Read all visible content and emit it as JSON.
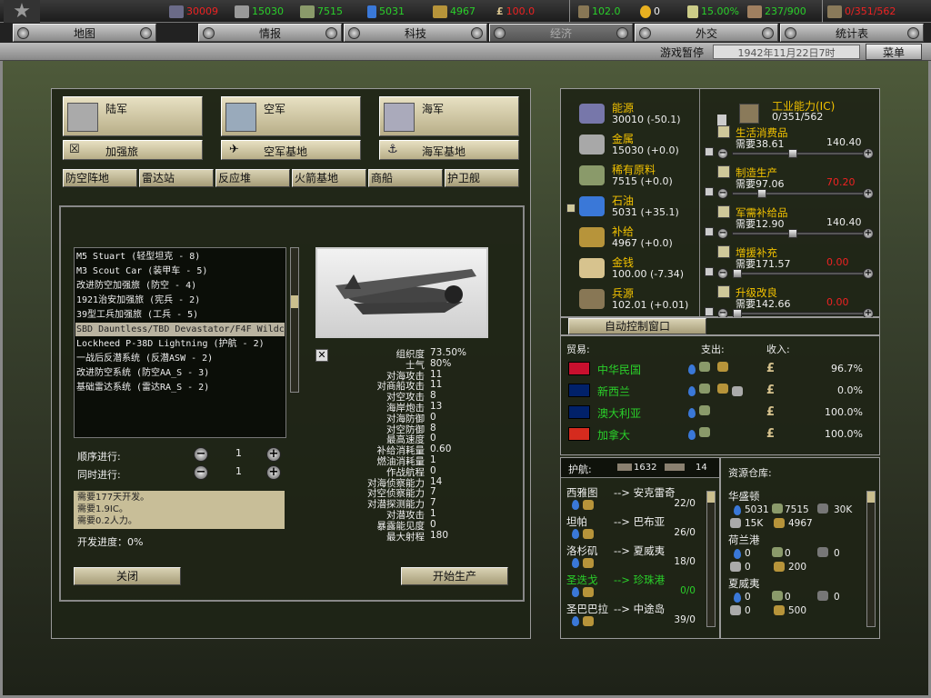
{
  "topbar": {
    "r1": "30009",
    "r2": "15030",
    "r3": "7515",
    "r4": "5031",
    "r5": "4967",
    "r6": "100.0",
    "r7": "102.0",
    "r8": "0",
    "r9": "15.00%",
    "r10": "237/900",
    "r11": "0/351/562"
  },
  "tabs": [
    "地图",
    "情报",
    "科技",
    "经济",
    "外交",
    "统计表"
  ],
  "status": {
    "pause": "游戏暂停",
    "date": "1942年11月22日7时",
    "menu": "菜单"
  },
  "branches": {
    "army": "陆军",
    "air": "空军",
    "navy": "海军",
    "brigade": "加强旅",
    "airbase": "空军基地",
    "navalbase": "海军基地"
  },
  "cats": [
    "防空阵地",
    "雷达站",
    "反应堆",
    "火箭基地",
    "商船",
    "护卫舰"
  ],
  "list": [
    "M5 Stuart (轻型坦克 - 8)",
    "M3 Scout Car (装甲车 - 5)",
    "改进防空加强旅 (防空 - 4)",
    "1921治安加强旅 (宪兵 - 2)",
    "39型工兵加强旅 (工兵 - 5)",
    "SBD Dauntless/TBD Devastator/F4F Wildcat (舰载 - 5)",
    "Lockheed P-38D Lightning (护航 - 2)",
    "一战后反潜系统 (反潜ASW - 2)",
    "改进防空系统 (防空AA_S - 3)",
    "基础雷达系统 (雷达RA_S - 2)"
  ],
  "stats": {
    "labels": [
      "组织度",
      "士气",
      "对海攻击",
      "对商船攻击",
      "对空攻击",
      "海岸炮击",
      "对海防御",
      "对空防御",
      "最高速度",
      "补给消耗量",
      "燃油消耗量",
      "作战航程",
      "对海侦察能力",
      "对空侦察能力",
      "对潜探测能力",
      "对潜攻击",
      "暴露能见度",
      "最大射程"
    ],
    "values": [
      "73.50%",
      "80%",
      "11",
      "11",
      "8",
      "13",
      "0",
      "8",
      "0",
      "0.60",
      "1",
      "0",
      "14",
      "7",
      "7",
      "1",
      "0",
      "180"
    ]
  },
  "prod": {
    "serial": "顺序进行:",
    "parallel": "同时进行:",
    "serial_val": "1",
    "parallel_val": "1",
    "info": [
      "需要177天开发。",
      "需要1.9IC。",
      "需要0.2人力。"
    ],
    "progress": "开发进度：0%",
    "close": "关闭",
    "start": "开始生产"
  },
  "resources": [
    {
      "name": "能源",
      "val": "30010 (-50.1)"
    },
    {
      "name": "金属",
      "val": "15030 (+0.0)"
    },
    {
      "name": "稀有原料",
      "val": "7515 (+0.0)"
    },
    {
      "name": "石油",
      "val": "5031 (+35.1)"
    },
    {
      "name": "补给",
      "val": "4967 (+0.0)"
    },
    {
      "name": "金钱",
      "val": "100.00 (-7.34)"
    },
    {
      "name": "兵源",
      "val": "102.01 (+0.01)"
    }
  ],
  "ic": {
    "title": "工业能力(IC)",
    "val": "0/351/562"
  },
  "alloc": [
    {
      "name": "生活消费品",
      "need": "需要38.61",
      "val": "140.40",
      "pos": 0.45,
      "red": false
    },
    {
      "name": "制造生产",
      "need": "需要97.06",
      "val": "70.20",
      "pos": 0.2,
      "red": true
    },
    {
      "name": "军需补给品",
      "need": "需要12.90",
      "val": "140.40",
      "pos": 0.45,
      "red": false
    },
    {
      "name": "增援补充",
      "need": "需要171.57",
      "val": "0.00",
      "pos": 0.0,
      "red": true
    },
    {
      "name": "升级改良",
      "need": "需要142.66",
      "val": "0.00",
      "pos": 0.0,
      "red": true
    }
  ],
  "autoctrl": "自动控制窗口",
  "trade": {
    "h1": "贸易:",
    "h2": "支出:",
    "h3": "收入:",
    "rows": [
      {
        "name": "中华民国",
        "pct": "96.7%",
        "flag": "#c8102e"
      },
      {
        "name": "新西兰",
        "pct": "0.0%",
        "flag": "#012169"
      },
      {
        "name": "澳大利亚",
        "pct": "100.0%",
        "flag": "#012169"
      },
      {
        "name": "加拿大",
        "pct": "100.0%",
        "flag": "#d52b1e"
      }
    ]
  },
  "convoy": {
    "title": "护航:",
    "n1": "1632",
    "n2": "14",
    "routes": [
      {
        "from": "西雅图",
        "to": "--> 安克雷奇",
        "num": "22/0",
        "green": false
      },
      {
        "from": "坦帕",
        "to": "--> 巴布亚",
        "num": "26/0",
        "green": false
      },
      {
        "from": "洛杉矶",
        "to": "--> 夏威夷",
        "num": "18/0",
        "green": false
      },
      {
        "from": "圣迭戈",
        "to": "--> 珍珠港",
        "num": "0/0",
        "green": true
      },
      {
        "from": "圣巴巴拉",
        "to": "--> 中途岛",
        "num": "39/0",
        "green": false
      }
    ]
  },
  "depot": {
    "title": "资源仓库:",
    "rows": [
      {
        "name": "华盛顿",
        "a": "5031",
        "b": "7515",
        "c": "30K",
        "d": "15K",
        "e": "4967"
      },
      {
        "name": "荷兰港",
        "a": "0",
        "b": "0",
        "c": "0",
        "d": "0",
        "e": "200"
      },
      {
        "name": "夏威夷",
        "a": "0",
        "b": "0",
        "c": "0",
        "d": "0",
        "e": "500"
      }
    ]
  },
  "colors": {
    "accent": "#f2c200",
    "green": "#2ad02a",
    "red": "#e22222"
  }
}
